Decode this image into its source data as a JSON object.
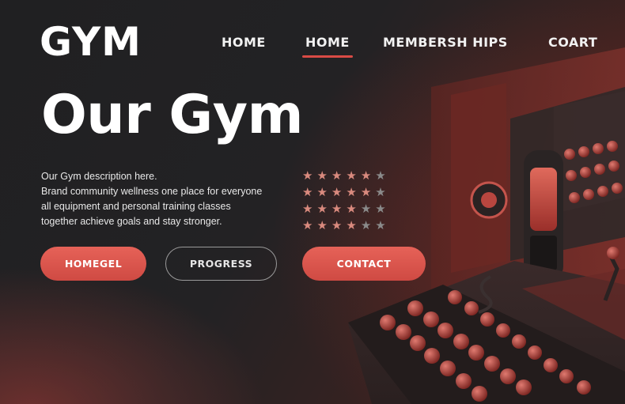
{
  "brand": {
    "logo": "GYM"
  },
  "nav": {
    "items": [
      {
        "label": "HOME"
      },
      {
        "label": "HOME",
        "active": true
      },
      {
        "label": "MEMBERSH  HIPS"
      },
      {
        "label": "COART"
      }
    ]
  },
  "hero": {
    "title": "Our Gym",
    "description": [
      "Our Gym description here.",
      "Brand community wellness one place for everyone",
      "all equipment and personal training classes",
      "together achieve goals and stay stronger."
    ]
  },
  "ratings": {
    "rows": [
      {
        "filled": 5,
        "total": 6
      },
      {
        "filled": 5,
        "total": 6
      },
      {
        "filled": 4,
        "total": 6
      },
      {
        "filled": 4,
        "total": 6
      }
    ],
    "star_color": "#d98a7e",
    "star_dim_color": "#8a8a8a"
  },
  "buttons": {
    "left": "HOMEGEL",
    "middle": "PROGRESS",
    "contact": "CONTACT"
  },
  "colors": {
    "accent": "#d94b45",
    "background": "#1c1c1e"
  }
}
